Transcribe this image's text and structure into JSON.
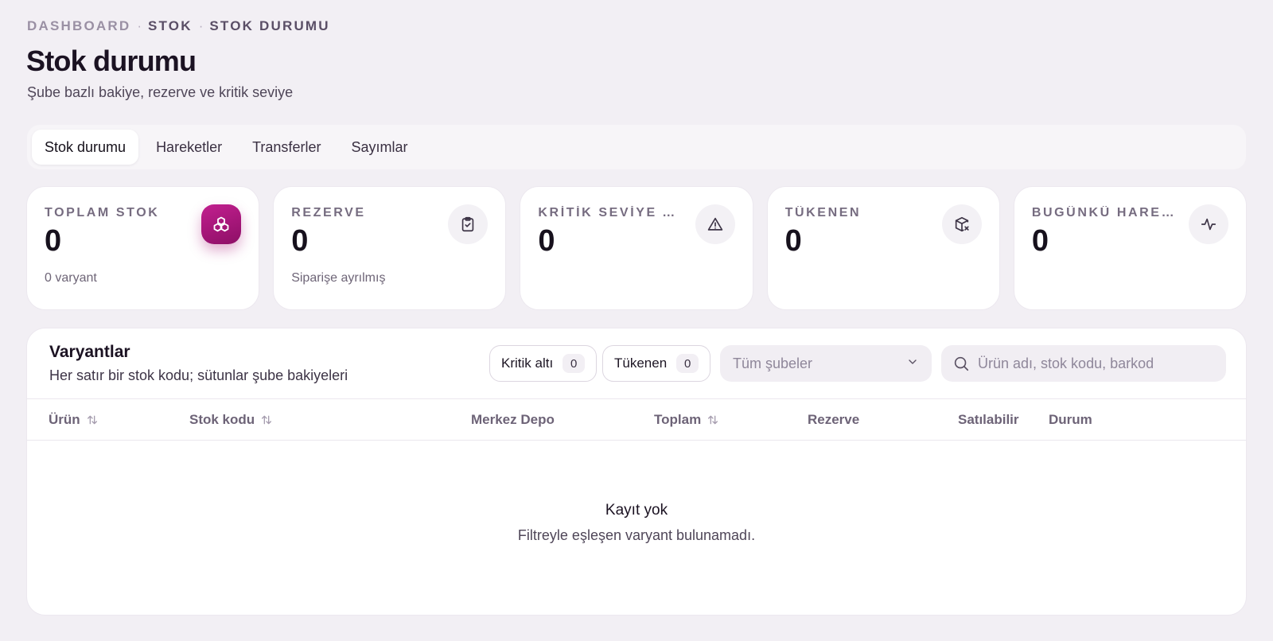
{
  "breadcrumb": [
    {
      "label": "DASHBOARD"
    },
    {
      "label": "STOK"
    },
    {
      "label": "STOK DURUMU"
    }
  ],
  "page": {
    "title": "Stok durumu",
    "subtitle": "Şube bazlı bakiye, rezerve ve kritik seviye"
  },
  "tabs": [
    {
      "label": "Stok durumu",
      "active": true
    },
    {
      "label": "Hareketler",
      "active": false
    },
    {
      "label": "Transferler",
      "active": false
    },
    {
      "label": "Sayımlar",
      "active": false
    }
  ],
  "cards": [
    {
      "label": "TOPLAM STOK",
      "value": "0",
      "sub": "0 varyant",
      "icon": "boxes-icon"
    },
    {
      "label": "REZERVE",
      "value": "0",
      "sub": "Siparişe ayrılmış",
      "icon": "clipboard-check-icon"
    },
    {
      "label": "KRİTİK SEVİYE A…",
      "value": "0",
      "sub": "",
      "icon": "warning-icon"
    },
    {
      "label": "TÜKENEN",
      "value": "0",
      "sub": "",
      "icon": "package-x-icon"
    },
    {
      "label": "BUGÜNKÜ HARE…",
      "value": "0",
      "sub": "",
      "icon": "activity-icon"
    }
  ],
  "variants": {
    "title": "Varyantlar",
    "description": "Her satır bir stok kodu; sütunlar şube bakiyeleri",
    "filters": [
      {
        "label": "Kritik altı",
        "count": "0"
      },
      {
        "label": "Tükenen",
        "count": "0"
      }
    ],
    "branch_select": {
      "value": "Tüm şubeler"
    },
    "search": {
      "placeholder": "Ürün adı, stok kodu, barkod"
    },
    "columns": [
      {
        "label": "Ürün",
        "sortable": true
      },
      {
        "label": "Stok kodu",
        "sortable": true
      },
      {
        "label": "Merkez Depo",
        "sortable": false
      },
      {
        "label": "Toplam",
        "sortable": true
      },
      {
        "label": "Rezerve",
        "sortable": false
      },
      {
        "label": "Satılabilir",
        "sortable": false
      },
      {
        "label": "Durum",
        "sortable": false
      }
    ],
    "empty": {
      "title": "Kayıt yok",
      "description": "Filtreyle eşleşen varyant bulunamadı."
    }
  },
  "colors": {
    "accent": "#a8157a",
    "background": "#f2eff4"
  }
}
